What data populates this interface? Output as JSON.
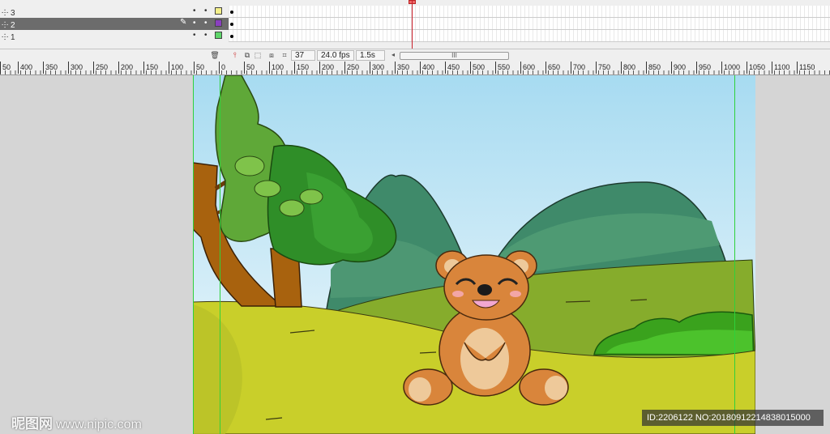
{
  "timeline": {
    "layers": [
      {
        "name": "3",
        "swatch_color": "#f4f08a",
        "selected": false
      },
      {
        "name": "2",
        "swatch_color": "#8a3fbf",
        "selected": true
      },
      {
        "name": "1",
        "swatch_color": "#5ed66a",
        "selected": false
      }
    ],
    "current_frame": "37",
    "fps": "24.0 fps",
    "elapsed": "1.5s",
    "scroll_thumb": "III",
    "layer_icon": "layer-icon",
    "pencil_icon": "pencil-icon"
  },
  "ruler": {
    "labels": [
      "50",
      "400",
      "350",
      "300",
      "250",
      "200",
      "150",
      "100",
      "50",
      "0",
      "50",
      "100",
      "150",
      "200",
      "250",
      "300",
      "350",
      "400",
      "450",
      "500",
      "550",
      "600",
      "650",
      "700",
      "750",
      "800",
      "850",
      "900",
      "950",
      "1000",
      "1050",
      "1100",
      "1150"
    ]
  },
  "stage": {
    "sky_top": "#a9dcf1",
    "grass": "#c9cf2a",
    "hills": "#3f8a6a",
    "bear": "#d9853b",
    "guide_color": "#2fd13b"
  },
  "watermark": {
    "brand": "昵图网",
    "site": "www.nipic.com",
    "id_text": "ID:2206122 NO:20180912214838015000"
  }
}
